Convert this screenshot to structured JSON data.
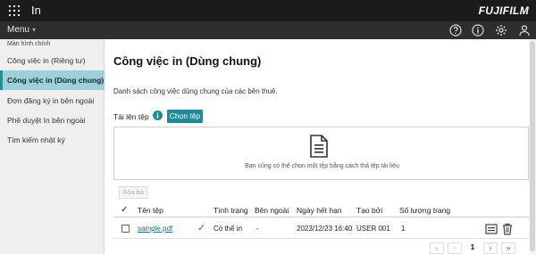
{
  "app": {
    "title": "In",
    "brand": "FUJIFILM",
    "menu_label": "Menu"
  },
  "top_icons": [
    "help-circle-icon",
    "info-circle-icon",
    "gear-icon",
    "user-icon"
  ],
  "sidebar": {
    "heading": "Màn hình chính",
    "items": [
      {
        "label": "Công việc in (Riêng tư)",
        "active": false
      },
      {
        "label": "Công việc in (Dùng chung)",
        "active": true
      },
      {
        "label": "Đơn đăng ký in bên ngoài",
        "active": false
      },
      {
        "label": "Phê duyệt In bên ngoài",
        "active": false
      },
      {
        "label": "Tìm kiếm nhật ký",
        "active": false
      }
    ]
  },
  "main": {
    "title": "Công việc in (Dùng chung)",
    "description": "Danh sách công việc dùng chung của các bên thuê.",
    "upload_label": "Tải lên tệp",
    "choose_button": "Chọn tệp",
    "dropzone_text": "Bạn cũng có thể chọn một tệp bằng cách thả tệp tải liệu",
    "delete_button": "Xóa bỏ",
    "table": {
      "columns": [
        "Tên tệp",
        "Tình trạng",
        "Bên ngoài",
        "Ngày hết hạn",
        "Tạo bởi",
        "Số lượng trang"
      ],
      "rows": [
        {
          "file_name": "sample.pdf",
          "status": "Có thể in",
          "external": "-",
          "expiry": "2023/12/23 16:40",
          "created_by": "USER 001",
          "pages": "1"
        }
      ]
    },
    "pagination": {
      "first": "«",
      "prev": "‹",
      "current": "1",
      "next": "›",
      "last": "»"
    }
  },
  "colors": {
    "accent": "#1f8a99",
    "active_item": "#9ed0d8",
    "topbar": "#1b1b1b",
    "menubar": "#2e2e2e",
    "status_check": "#2e8b3a"
  }
}
